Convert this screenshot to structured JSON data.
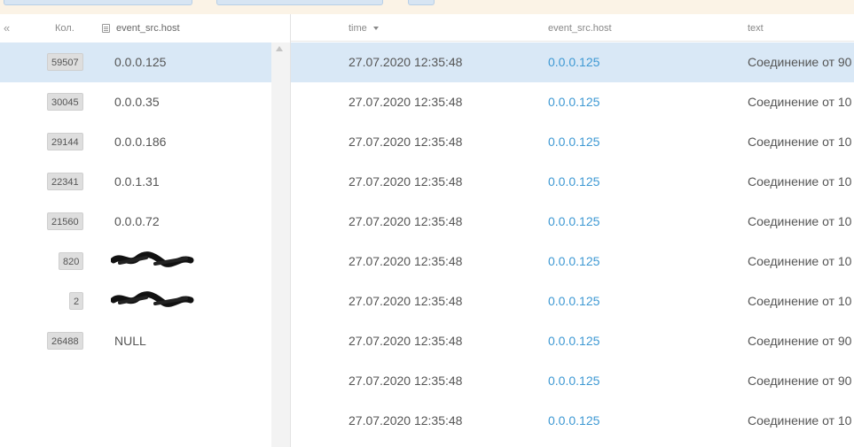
{
  "left_panel": {
    "collapse_icon": "«",
    "col_count_label": "Кол.",
    "col_host_label": "event_src.host",
    "rows": [
      {
        "count": "59507",
        "value": "0.0.0.125",
        "selected": true
      },
      {
        "count": "30045",
        "value": "0.0.0.35"
      },
      {
        "count": "29144",
        "value": "0.0.0.186"
      },
      {
        "count": "22341",
        "value": "0.0.1.31"
      },
      {
        "count": "21560",
        "value": "0.0.0.72"
      },
      {
        "count": "820",
        "value": "",
        "obscured": true
      },
      {
        "count": "2",
        "value": "",
        "obscured": true
      },
      {
        "count": "26488",
        "value": "NULL"
      }
    ]
  },
  "events": {
    "columns": {
      "time": "time",
      "host": "event_src.host",
      "text": "text"
    },
    "rows": [
      {
        "time": "27.07.2020 12:35:48",
        "host": "0.0.0.125",
        "text": "Соединение от 90",
        "selected": true
      },
      {
        "time": "27.07.2020 12:35:48",
        "host": "0.0.0.125",
        "text": "Соединение от 10"
      },
      {
        "time": "27.07.2020 12:35:48",
        "host": "0.0.0.125",
        "text": "Соединение от 10"
      },
      {
        "time": "27.07.2020 12:35:48",
        "host": "0.0.0.125",
        "text": "Соединение от 10"
      },
      {
        "time": "27.07.2020 12:35:48",
        "host": "0.0.0.125",
        "text": "Соединение от 10"
      },
      {
        "time": "27.07.2020 12:35:48",
        "host": "0.0.0.125",
        "text": "Соединение от 10"
      },
      {
        "time": "27.07.2020 12:35:48",
        "host": "0.0.0.125",
        "text": "Соединение от 10"
      },
      {
        "time": "27.07.2020 12:35:48",
        "host": "0.0.0.125",
        "text": "Соединение от 90"
      },
      {
        "time": "27.07.2020 12:35:48",
        "host": "0.0.0.125",
        "text": "Соединение от 90"
      },
      {
        "time": "27.07.2020 12:35:48",
        "host": "0.0.0.125",
        "text": "Соединение от 10"
      }
    ]
  },
  "colors": {
    "selection": "#d9e8f6",
    "host_link": "#3d98d3",
    "toolbar": "#fbf3e6"
  }
}
